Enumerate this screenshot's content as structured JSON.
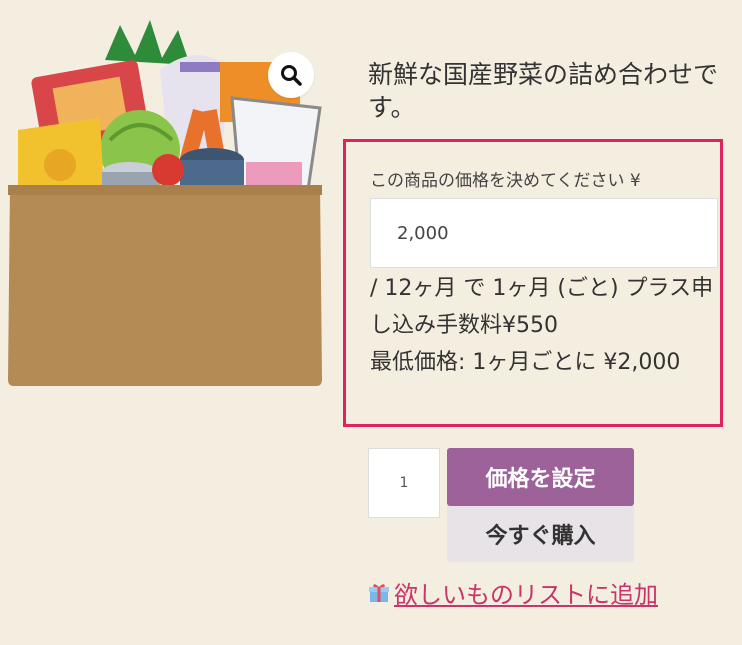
{
  "product": {
    "image_alt": "vegetable box",
    "description": "新鮮な国産野菜の詰め合わせです。"
  },
  "icons": {
    "zoom": "magnifier-icon",
    "gift": "gift-icon"
  },
  "name_your_price": {
    "label": "この商品の価格を決めてください ¥",
    "value": "2,000",
    "terms_line1": " / 12ヶ月 で 1ヶ月 (ごと) プラス申し込み手数料¥550",
    "terms_line2": "最低価格: 1ヶ月ごとに ¥2,000",
    "accent": "#e0235f"
  },
  "cart": {
    "quantity": "1",
    "set_price_label": "価格を設定",
    "buy_now_label": "今すぐ購入",
    "primary_color": "#9d6299"
  },
  "wishlist": {
    "label": "欲しいものリストに追加"
  }
}
